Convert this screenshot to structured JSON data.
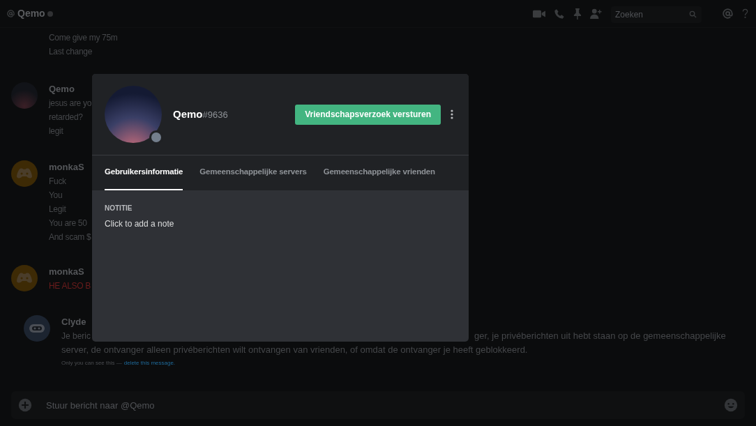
{
  "header": {
    "channel": "Qemo",
    "search": {
      "placeholder": "Zoeken"
    }
  },
  "messages": [
    {
      "kind": "continuation",
      "alert": false,
      "lines": [
        "Come give my 75m",
        "Last change"
      ]
    },
    {
      "kind": "member",
      "author": "Qemo",
      "alert": false,
      "lines": [
        "jesus are yo",
        "retarded?",
        "legit"
      ]
    },
    {
      "kind": "guest",
      "author": "monkaS",
      "alert": false,
      "lines": [
        "Fuck",
        "You",
        "Legit",
        "You are 50",
        "And scam $"
      ]
    },
    {
      "kind": "guest",
      "author": "monkaS",
      "alert": true,
      "lines": [
        "HE ALSO B"
      ]
    },
    {
      "kind": "bot",
      "author": "Clyde",
      "alert": false,
      "line_left": "Je beric",
      "line_right": "ger, je privéberichten uit hebt staan op de gemeenschappelijke",
      "lines": [
        "server, de ontvanger alleen privéberichten wilt ontvangen van vrienden, of omdat de ontvanger je heeft geblokkeerd."
      ],
      "note": "Only you can see this —",
      "note_link": "delete this message."
    }
  ],
  "composer": {
    "placeholder": "Stuur bericht naar @Qemo"
  },
  "profile": {
    "username": "Qemo",
    "discriminator": "#9636",
    "online": false,
    "action": "Vriendschapsverzoek versturen",
    "tabs": [
      {
        "label": "Gebruikersinformatie",
        "selected": true
      },
      {
        "label": "Gemeenschappelijke servers",
        "selected": false
      },
      {
        "label": "Gemeenschappelijke vrienden",
        "selected": false
      }
    ],
    "note_heading": "NOTITIE",
    "note_placeholder": "Click to add a note"
  }
}
